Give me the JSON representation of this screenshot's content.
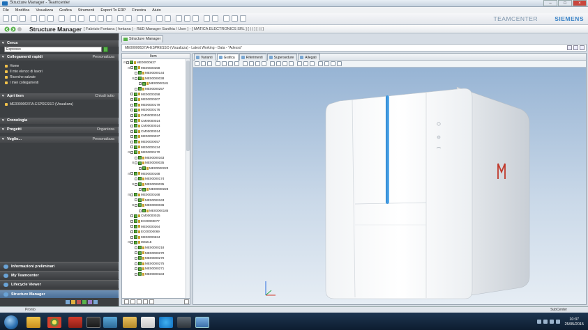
{
  "window": {
    "title": "Structure Manager - Teamcenter"
  },
  "menu": [
    "File",
    "Modifica",
    "Visualizza",
    "Grafica",
    "Strumenti",
    "Export To ERP",
    "Finestra",
    "Aiuto"
  ],
  "brand": {
    "left": "TEAMCENTER",
    "right": "SIEMENS"
  },
  "app": {
    "title": "Structure Manager",
    "context": "[ Fabrizio Fontana ( fontana ) - R&D Manager Santhia / User ] - [ MATICA ELECTRONICS SRL ] [ | | ] [ | | ]"
  },
  "left": {
    "search": {
      "header": "Cerca",
      "value": "Espresso"
    },
    "quick_links": {
      "header": "Collegamenti rapidi",
      "action": "Personalizza",
      "items": [
        "Home",
        "Il mio elenco di lavori",
        "Ricerche salvate",
        "I miei collegamenti"
      ]
    },
    "open_items": {
      "header": "Apri item",
      "action": "Chiudi tutto",
      "items": [
        "ME00000637/A-ESPRESSO (Visualizza)"
      ]
    },
    "history": {
      "header": "Cronologia"
    },
    "projects": {
      "header": "Progetti",
      "action": "Organizza"
    },
    "vorrei": {
      "header": "Voglio...",
      "action": "Personalizza"
    },
    "nav": [
      "Informazioni preliminari",
      "My Teamcenter",
      "Lifecycle Viewer",
      "Structure Manager"
    ]
  },
  "main": {
    "view_tab": "Structure Manager",
    "path": "ME00000637/A-ESPRESSO (Visualizza) - Latest Working - Data - \"Adesso\"",
    "tree_header": "Item",
    "tree_rows": [
      {
        "indent": 0,
        "id": "ME00000637"
      },
      {
        "indent": 1,
        "id": "ME00000258"
      },
      {
        "indent": 2,
        "id": "ME00000144"
      },
      {
        "indent": 2,
        "id": "ME00000038"
      },
      {
        "indent": 3,
        "id": "ME00000181"
      },
      {
        "indent": 2,
        "id": "ME00000257"
      },
      {
        "indent": 1,
        "id": "ME00000258"
      },
      {
        "indent": 1,
        "id": "ME00000207"
      },
      {
        "indent": 1,
        "id": "ME00000179"
      },
      {
        "indent": 1,
        "id": "ME00000176"
      },
      {
        "indent": 1,
        "id": "CM00000024"
      },
      {
        "indent": 1,
        "id": "CM00000024"
      },
      {
        "indent": 1,
        "id": "CM00000024"
      },
      {
        "indent": 1,
        "id": "CM00000024"
      },
      {
        "indent": 1,
        "id": "ME00000037"
      },
      {
        "indent": 1,
        "id": "ME00000057"
      },
      {
        "indent": 1,
        "id": "ME00000134"
      },
      {
        "indent": 1,
        "id": "ME00000170"
      },
      {
        "indent": 2,
        "id": "ME00000163"
      },
      {
        "indent": 2,
        "id": "ME00000035"
      },
      {
        "indent": 3,
        "id": "ME00000223"
      },
      {
        "indent": 1,
        "id": "ME00000168"
      },
      {
        "indent": 2,
        "id": "ME00000174"
      },
      {
        "indent": 2,
        "id": "ME00000035"
      },
      {
        "indent": 3,
        "id": "ME00000223"
      },
      {
        "indent": 1,
        "id": "ME00000168"
      },
      {
        "indent": 2,
        "id": "ME00000163"
      },
      {
        "indent": 2,
        "id": "ME00000036"
      },
      {
        "indent": 3,
        "id": "ME00000185"
      },
      {
        "indent": 1,
        "id": "CM00000025"
      },
      {
        "indent": 1,
        "id": "EC00000077"
      },
      {
        "indent": 1,
        "id": "ME00000264"
      },
      {
        "indent": 1,
        "id": "EC00000069"
      },
      {
        "indent": 1,
        "id": "ME00000634"
      },
      {
        "indent": 1,
        "id": "000215"
      },
      {
        "indent": 2,
        "id": "ME00000218"
      },
      {
        "indent": 2,
        "id": "ME00000270"
      },
      {
        "indent": 2,
        "id": "ME00000270"
      },
      {
        "indent": 2,
        "id": "ME00000275"
      },
      {
        "indent": 2,
        "id": "ME00000271"
      },
      {
        "indent": 2,
        "id": "ME00000184"
      }
    ],
    "subtabs": [
      "Varianti",
      "Grafica",
      "Riferimenti",
      "Supersedure",
      "Allegati"
    ],
    "active_subtab": "Grafica",
    "model_logo": "M"
  },
  "status": {
    "text": "Pronto",
    "right": "SubCenter"
  },
  "taskbar": {
    "time": "10:37",
    "date": "25/05/2015"
  },
  "colors": {
    "accent_blue": "#3a83c7",
    "tree_green": "#5aaf3c",
    "logo_red": "#c0392b",
    "sidebar": "#3c3f42"
  }
}
